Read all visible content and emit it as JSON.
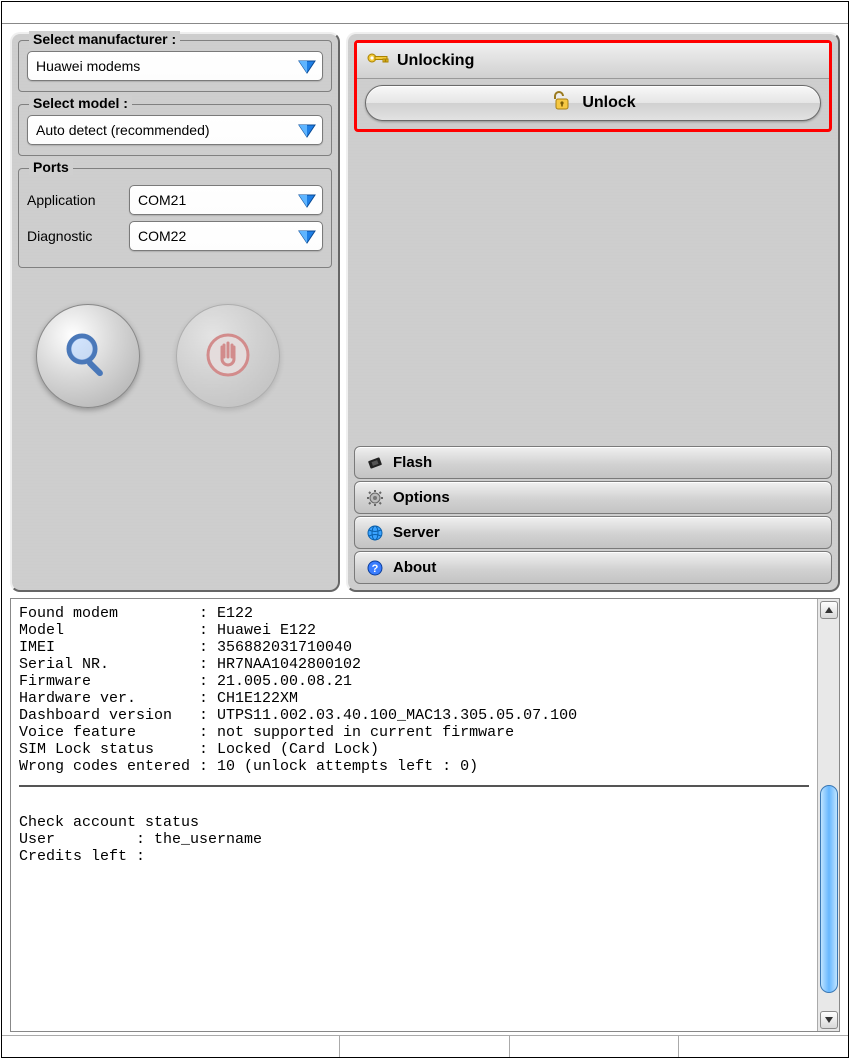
{
  "left": {
    "manufacturer": {
      "label": "Select manufacturer :",
      "value": "Huawei modems"
    },
    "model": {
      "label": "Select model :",
      "value": "Auto detect (recommended)"
    },
    "ports": {
      "label": "Ports",
      "application": {
        "label": "Application",
        "value": "COM21"
      },
      "diagnostic": {
        "label": "Diagnostic",
        "value": "COM22"
      }
    },
    "search_icon": "search-icon",
    "stop_icon": "stop-hand-icon"
  },
  "right": {
    "unlocking": {
      "header": "Unlocking",
      "button": "Unlock"
    },
    "sections": {
      "flash": "Flash",
      "options": "Options",
      "server": "Server",
      "about": "About"
    }
  },
  "log": {
    "line1": "Found modem         : E122",
    "line2": "Model               : Huawei E122",
    "line3": "IMEI                : 356882031710040",
    "line4": "Serial NR.          : HR7NAA1042800102",
    "line5": "Firmware            : 21.005.00.08.21",
    "line6": "Hardware ver.       : CH1E122XM",
    "line7": "Dashboard version   : UTPS11.002.03.40.100_MAC13.305.05.07.100",
    "line8": "Voice feature       : not supported in current firmware",
    "line9": "SIM Lock status     : Locked (Card Lock)",
    "line10": "Wrong codes entered : 10 (unlock attempts left : 0)",
    "line11": "Check account status",
    "line12": "User         : the_username",
    "line13": "Credits left :"
  }
}
